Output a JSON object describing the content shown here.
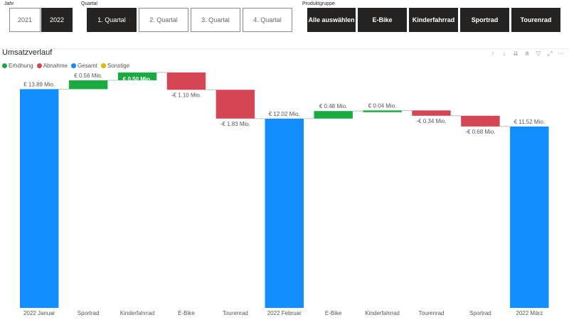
{
  "slicers": {
    "jahr": {
      "label": "Jahr",
      "items": [
        "2021",
        "2022"
      ],
      "selected": "2022"
    },
    "quartal": {
      "label": "Quartal",
      "items": [
        "1. Quartal",
        "2. Quartal",
        "3. Quartal",
        "4. Quartal"
      ],
      "selected": "1. Quartal"
    },
    "produktgruppe": {
      "label": "Produktgruppe",
      "items": [
        "Alle auswählen",
        "E-Bike",
        "Kinderfahrrad",
        "Sportrad",
        "Tourenrad"
      ]
    }
  },
  "colors": {
    "increase": "#1aab40",
    "decrease": "#d64554",
    "total": "#118dff",
    "other": "#e0b400",
    "connector": "#bdbdbd"
  },
  "chart_data": {
    "type": "waterfall",
    "title": "Umsatzverlauf",
    "legend": [
      {
        "name": "Erhöhung",
        "color": "#1aab40"
      },
      {
        "name": "Abnahme",
        "color": "#d64554"
      },
      {
        "name": "Gesamt",
        "color": "#118dff"
      },
      {
        "name": "Sonstige",
        "color": "#e0b400"
      }
    ],
    "legend_position": "top-left",
    "grid": false,
    "ylim": [
      0,
      14.9
    ],
    "categories": [
      "2022 Januar",
      "Sportrad",
      "Kinderfahrrad",
      "E-Bike",
      "Tourenrad",
      "2022 Februar",
      "E-Bike",
      "Kinderfahrrad",
      "Tourenrad",
      "Sportrad",
      "2022 März"
    ],
    "kinds": [
      "total",
      "increase",
      "increase",
      "decrease",
      "decrease",
      "total",
      "increase",
      "increase",
      "decrease",
      "decrease",
      "total"
    ],
    "values": [
      13.89,
      0.56,
      0.5,
      -1.1,
      -1.83,
      12.02,
      0.48,
      0.04,
      -0.34,
      -0.68,
      11.52
    ],
    "data_labels": [
      "€ 13.89 Mio.",
      "€ 0.56 Mio.",
      "€ 0.50 Mio.",
      "-€ 1.10 Mio.",
      "-€ 1.83 Mio.",
      "€ 12.02 Mio.",
      "€ 0.48 Mio.",
      "€ 0.04 Mio.",
      "-€ 0.34 Mio.",
      "-€ 0.68 Mio.",
      "€ 11.52 Mio."
    ]
  },
  "toolbar_icons": [
    "arrow-up-icon",
    "arrow-down-icon",
    "double-arrow-down-icon",
    "expand-hierarchy-icon",
    "filter-icon",
    "focus-mode-icon",
    "more-options-icon"
  ]
}
